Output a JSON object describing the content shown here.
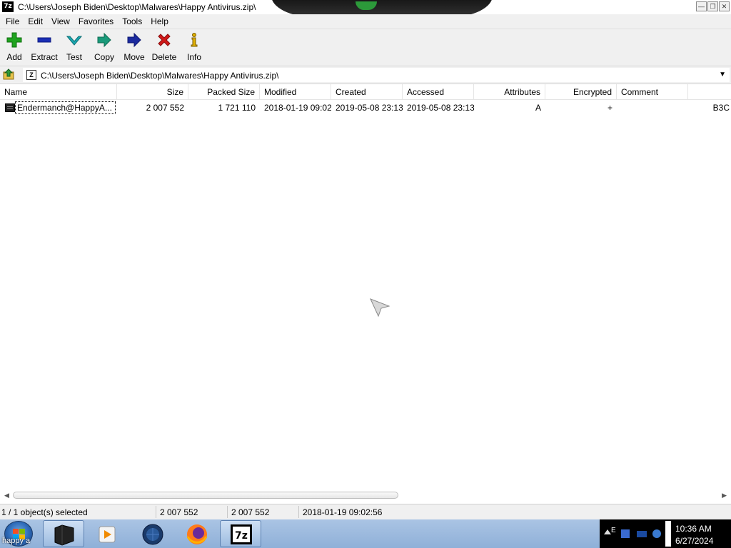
{
  "window": {
    "app_icon_text": "7z",
    "title": "C:\\Users\\Joseph Biden\\Desktop\\Malwares\\Happy Antivirus.zip\\"
  },
  "menu": {
    "items": [
      "File",
      "Edit",
      "View",
      "Favorites",
      "Tools",
      "Help"
    ]
  },
  "toolbar": {
    "buttons": [
      {
        "label": "Add",
        "icon": "plus-icon",
        "color": "#1fa31f"
      },
      {
        "label": "Extract",
        "icon": "minus-icon",
        "color": "#1b2fb5"
      },
      {
        "label": "Test",
        "icon": "check-icon",
        "color": "#1aa7b0"
      },
      {
        "label": "Copy",
        "icon": "arrow-right-icon",
        "color": "#1a9a7a"
      },
      {
        "label": "Move",
        "icon": "arrow-right-icon",
        "color": "#1b2a9e"
      },
      {
        "label": "Delete",
        "icon": "x-icon",
        "color": "#d01818"
      },
      {
        "label": "Info",
        "icon": "info-icon",
        "color": "#e0b000"
      }
    ]
  },
  "address": {
    "path": "C:\\Users\\Joseph Biden\\Desktop\\Malwares\\Happy Antivirus.zip\\"
  },
  "table": {
    "columns": [
      "Name",
      "Size",
      "Packed Size",
      "Modified",
      "Created",
      "Accessed",
      "Attributes",
      "Encrypted",
      "Comment"
    ],
    "rows": [
      {
        "name": "Endermanch@HappyA...",
        "size": "2 007 552",
        "packed_size": "1 721 110",
        "modified": "2018-01-19 09:02",
        "created": "2019-05-08 23:13",
        "accessed": "2019-05-08 23:13",
        "attributes": "A",
        "encrypted": "+",
        "comment": "",
        "overflow": "B3C"
      }
    ]
  },
  "status": {
    "selection": "1 / 1 object(s) selected",
    "size": "2 007 552",
    "packed": "2 007 552",
    "modified": "2018-01-19 09:02:56"
  },
  "taskbar": {
    "start_label": "happy a",
    "apps": [
      "terminal-app",
      "media-player-app",
      "globe-app",
      "firefox-app",
      "7zip-app"
    ],
    "tray_icon_text": "E",
    "clock_time": "10:36 AM",
    "clock_date": "6/27/2024"
  }
}
